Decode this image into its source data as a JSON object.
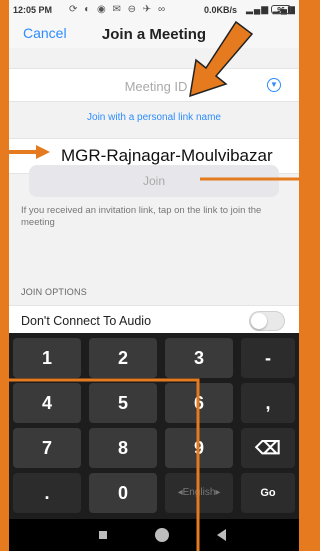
{
  "status_bar": {
    "time": "12:05 PM",
    "notification_glyphs": "⟳ ◐ ◉ ✉ ⊖ ✈ ∞",
    "network_speed": "0.0KB/s",
    "signal": "▂▄▆ ▂▄▆",
    "battery": "96"
  },
  "header": {
    "cancel_label": "Cancel",
    "title": "Join a Meeting"
  },
  "meeting_id": {
    "placeholder": "Meeting ID",
    "dropdown_icon": "chevron-down-icon"
  },
  "personal_link_label": "Join with a personal link name",
  "name_field": {
    "value": "MGR-Rajnagar-Moulvibazar"
  },
  "join_button_label": "Join",
  "invite_note": "If you received an invitation link, tap on the link to join the meeting",
  "join_options": {
    "heading": "JOIN OPTIONS",
    "audio_label": "Don't Connect To Audio",
    "audio_toggle_on": false
  },
  "keyboard": {
    "keys": [
      {
        "label": "1",
        "name": "key-1"
      },
      {
        "label": "2",
        "name": "key-2"
      },
      {
        "label": "3",
        "name": "key-3"
      },
      {
        "label": "-",
        "name": "key-minus",
        "fn": true
      },
      {
        "label": "4",
        "name": "key-4"
      },
      {
        "label": "5",
        "name": "key-5"
      },
      {
        "label": "6",
        "name": "key-6"
      },
      {
        "label": ",",
        "name": "key-comma",
        "fn": true
      },
      {
        "label": "7",
        "name": "key-7"
      },
      {
        "label": "8",
        "name": "key-8"
      },
      {
        "label": "9",
        "name": "key-9"
      },
      {
        "label": "⌫",
        "name": "key-backspace",
        "fn": true
      },
      {
        "label": ".",
        "name": "key-period",
        "fn": true
      },
      {
        "label": "0",
        "name": "key-0"
      },
      {
        "label": "◂English▸",
        "name": "key-language",
        "fn": true,
        "lang": true
      },
      {
        "label": "Go",
        "name": "key-go",
        "fn": true,
        "small": true
      }
    ]
  },
  "colors": {
    "accent": "#2d8cff",
    "annotation": "#e57a1f"
  }
}
